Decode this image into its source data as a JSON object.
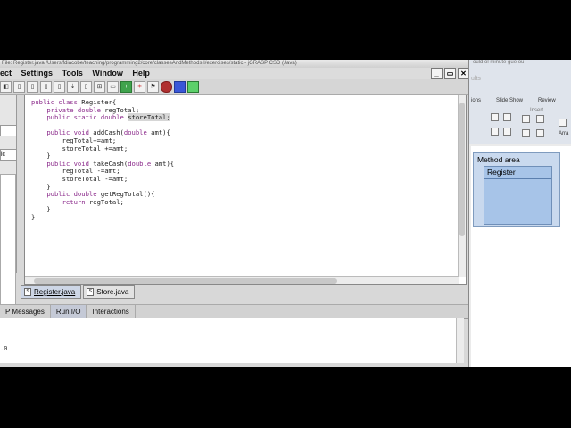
{
  "window": {
    "title": "File: Register.java   /Users/fdiacobe/teaching/programming2/core/classesAndMethodsII/exercises/static - jGRASP CSD (Java)"
  },
  "menu": [
    "ect",
    "Settings",
    "Tools",
    "Window",
    "Help"
  ],
  "window_buttons": [
    "_",
    "▭",
    "✕"
  ],
  "left_panel": {
    "combo_label": "ic"
  },
  "code_lines": [
    "public class Register{",
    "    private double regTotal;",
    "    public static double storeTotal;",
    "",
    "    public void addCash(double amt){",
    "        regTotal+=amt;",
    "        storeTotal +=amt;",
    "    }",
    "    public void takeCash(double amt){",
    "        regTotal -=amt;",
    "        storeTotal -=amt;",
    "    }",
    "    public double getRegTotal(){",
    "        return regTotal;",
    "    }",
    "}"
  ],
  "file_tabs": [
    {
      "label": "Register.java",
      "active": true
    },
    {
      "label": "Store.java",
      "active": false
    }
  ],
  "message_tabs": [
    {
      "label": "P Messages",
      "active": false
    },
    {
      "label": "Run I/O",
      "active": true
    },
    {
      "label": "Interactions",
      "active": false
    }
  ],
  "output_text": ".0",
  "right_panel": {
    "top_text": "ould ol minute gue ou",
    "faded_text": "ults",
    "ribbon_tabs": [
      "ions",
      "Slide Show",
      "Review"
    ],
    "insert_label": "Insert",
    "arrange_label": "Arra",
    "method_area_label": "Method area",
    "register_label": "Register"
  }
}
